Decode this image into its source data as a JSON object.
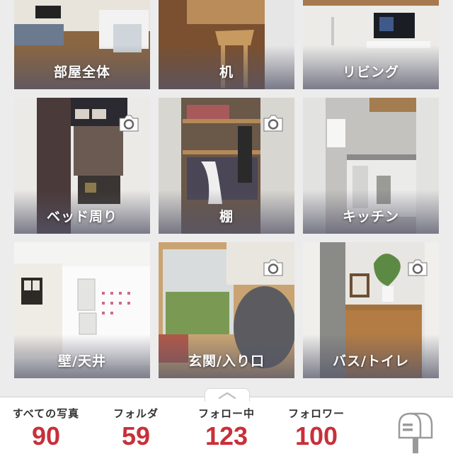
{
  "folders": [
    {
      "label": "部屋全体",
      "has_camera": false
    },
    {
      "label": "机",
      "has_camera": false
    },
    {
      "label": "リビング",
      "has_camera": false
    },
    {
      "label": "ベッド周り",
      "has_camera": true
    },
    {
      "label": "棚",
      "has_camera": true
    },
    {
      "label": "キッチン",
      "has_camera": false
    },
    {
      "label": "壁/天井",
      "has_camera": false
    },
    {
      "label": "玄関/入り口",
      "has_camera": true
    },
    {
      "label": "バス/トイレ",
      "has_camera": true
    }
  ],
  "stats": {
    "photos": {
      "label": "すべての写真",
      "value": "90"
    },
    "folders": {
      "label": "フォルダ",
      "value": "59"
    },
    "following": {
      "label": "フォロー中",
      "value": "123"
    },
    "followers": {
      "label": "フォロワー",
      "value": "100"
    }
  },
  "icons": {
    "camera": "camera-icon",
    "mailbox": "mailbox-icon",
    "chevron": "chevron-up-icon"
  },
  "colors": {
    "stat_value": "#c8303a",
    "background": "#ececec"
  }
}
